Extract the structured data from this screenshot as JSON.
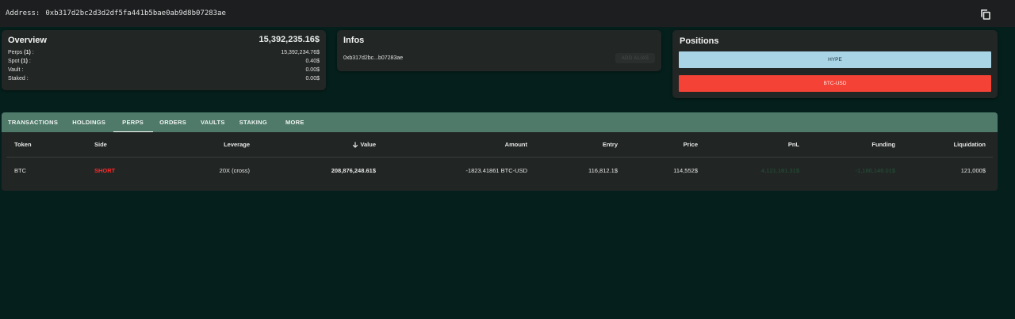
{
  "address_bar": {
    "label": "Address:",
    "address": "0xb317d2bc2d3d2df5fa441b5bae0ab9d8b07283ae",
    "copy_icon": "copy-icon"
  },
  "overview": {
    "title": "Overview",
    "total": "15,392,235.16$",
    "rows": [
      {
        "label": "Perps ",
        "count": "(1)",
        "suffix": " :",
        "value": "15,392,234.76$"
      },
      {
        "label": "Spot ",
        "count": "(1)",
        "suffix": " :",
        "value": "0.40$"
      },
      {
        "label": "Vault :",
        "count": "",
        "suffix": "",
        "value": "0.00$"
      },
      {
        "label": "Staked :",
        "count": "",
        "suffix": "",
        "value": "0.00$"
      }
    ]
  },
  "infos": {
    "title": "Infos",
    "short_address": "0xb317d2bc...b07283ae",
    "add_alias_label": "ADD ALIAS"
  },
  "positions": {
    "title": "Positions",
    "items": [
      "HYPE",
      "BTC-USD"
    ],
    "colors": {
      "hype": "#a8d4e6",
      "btc": "#f44336"
    }
  },
  "tabs": [
    {
      "label": "TRANSACTIONS",
      "active": false
    },
    {
      "label": "HOLDINGS",
      "active": false
    },
    {
      "label": "PERPS",
      "active": true
    },
    {
      "label": "ORDERS",
      "active": false
    },
    {
      "label": "VAULTS",
      "active": false
    },
    {
      "label": "STAKING",
      "active": false
    },
    {
      "label": "MORE",
      "active": false
    }
  ],
  "table": {
    "headers": {
      "token": "Token",
      "side": "Side",
      "leverage": "Leverage",
      "value": "Value",
      "amount": "Amount",
      "entry": "Entry",
      "price": "Price",
      "pnl": "PnL",
      "funding": "Funding",
      "liquidation": "Liquidation"
    },
    "rows": [
      {
        "token": "BTC",
        "side": "SHORT",
        "leverage": "20X (cross)",
        "value": "208,876,248.61$",
        "amount": "-1823.41861 BTC-USD",
        "entry": "116,812.1$",
        "price": "114,552$",
        "pnl": "4,121,181.31$",
        "funding": "-1,180,146.01$",
        "liquidation": "121,000$"
      }
    ]
  },
  "theme": {
    "background": "#05201c",
    "tab_bar": "#4f7a6a",
    "short_color": "#ff2a2a"
  }
}
